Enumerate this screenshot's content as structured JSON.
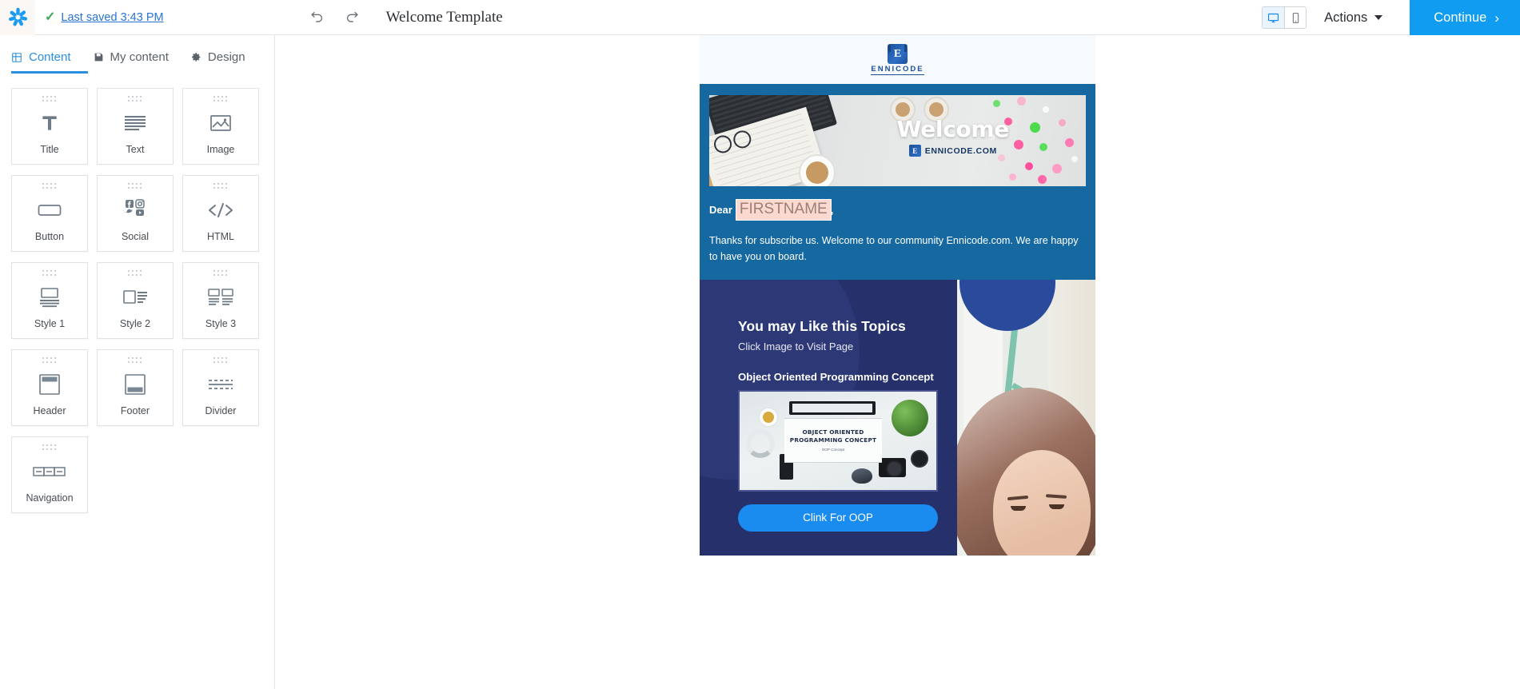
{
  "topbar": {
    "logo_icon": "app-logo-icon",
    "check_icon": "checkmark-icon",
    "saved_text": "Last saved 3:43 PM",
    "undo_icon": "undo-icon",
    "redo_icon": "redo-icon",
    "document_title": "Welcome Template",
    "desktop_icon": "desktop-monitor-icon",
    "mobile_icon": "mobile-phone-icon",
    "actions_label": "Actions",
    "continue_label": "Continue"
  },
  "sidebar": {
    "tabs": [
      {
        "label": "Content",
        "icon": "grid-layout-icon",
        "active": true
      },
      {
        "label": "My content",
        "icon": "save-disk-icon",
        "active": false
      },
      {
        "label": "Design",
        "icon": "gear-icon",
        "active": false
      }
    ],
    "blocks": [
      {
        "label": "Title",
        "icon": "title-T-icon"
      },
      {
        "label": "Text",
        "icon": "text-lines-icon"
      },
      {
        "label": "Image",
        "icon": "image-picture-icon"
      },
      {
        "label": "Button",
        "icon": "button-rounded-rect-icon"
      },
      {
        "label": "Social",
        "icon": "social-networks-icon"
      },
      {
        "label": "HTML",
        "icon": "code-brackets-icon"
      },
      {
        "label": "Style 1",
        "icon": "image-above-text-icon"
      },
      {
        "label": "Style 2",
        "icon": "image-left-text-right-icon"
      },
      {
        "label": "Style 3",
        "icon": "two-column-image-text-icon"
      },
      {
        "label": "Header",
        "icon": "header-bar-icon"
      },
      {
        "label": "Footer",
        "icon": "footer-bar-icon"
      },
      {
        "label": "Divider",
        "icon": "dashed-divider-icon"
      },
      {
        "label": "Navigation",
        "icon": "navigation-menu-icon"
      }
    ]
  },
  "email": {
    "brand": {
      "mark_letter": "E",
      "wordmark": "ENNICODE"
    },
    "hero": {
      "banner_title": "Welcome",
      "banner_brand_letter": "E",
      "banner_brand_word": "ENNICODE.COM",
      "greeting_label": "Dear",
      "merge_tag": "FIRSTNAME",
      "greeting_comma": ",",
      "body": "Thanks for subscribe us. Welcome to our community Ennicode.com. We are happy to have you on board."
    },
    "topics": {
      "title": "You may Like this Topics",
      "subtitle": "Click Image to Visit Page",
      "item_title": "Object Oriented Programming Concept",
      "card_heading_line1": "OBJECT ORIENTED",
      "card_heading_line2": "PROGRAMMING CONCEPT",
      "card_subheading": "OOP Concept",
      "cta_label": "Clink For OOP"
    }
  },
  "colors": {
    "accent_blue": "#109cf1",
    "link_blue": "#2a73d4",
    "hero_blue": "#1569a0",
    "navy": "#26306b",
    "merge_tag_bg": "#fbd9d0",
    "success_green": "#3aa757"
  }
}
